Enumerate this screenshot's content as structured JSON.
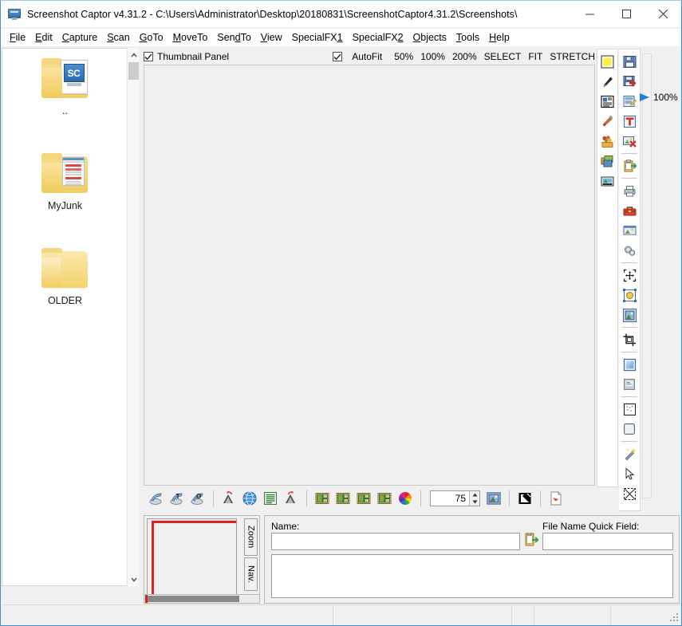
{
  "window": {
    "title": "Screenshot Captor v4.31.2 - C:\\Users\\Administrator\\Desktop\\20180831\\ScreenshotCaptor4.31.2\\Screenshots\\",
    "icon": "monitor-sc-icon",
    "minimize_label": "Minimize",
    "maximize_label": "Maximize",
    "close_label": "Close"
  },
  "menu": {
    "items": [
      {
        "label": "File",
        "accel": "F"
      },
      {
        "label": "Edit",
        "accel": "E"
      },
      {
        "label": "Capture",
        "accel": "C"
      },
      {
        "label": "Scan",
        "accel": "S"
      },
      {
        "label": "GoTo",
        "accel": "G"
      },
      {
        "label": "MoveTo",
        "accel": "M"
      },
      {
        "label": "SendTo",
        "accel": "T"
      },
      {
        "label": "View",
        "accel": "V"
      },
      {
        "label": "SpecialFX1",
        "accel": "1"
      },
      {
        "label": "SpecialFX2",
        "accel": "2"
      },
      {
        "label": "Objects",
        "accel": "O"
      },
      {
        "label": "Tools",
        "accel": "T"
      },
      {
        "label": "Help",
        "accel": "H"
      }
    ]
  },
  "file_browser": {
    "entries": [
      {
        "label": "..",
        "icon": "folder-with-sc-app-icon"
      },
      {
        "label": "MyJunk",
        "icon": "folder-with-screenshot-icon"
      },
      {
        "label": "OLDER",
        "icon": "folder-icon"
      }
    ],
    "scrollbar": {
      "up": "scroll-up-arrow",
      "down": "scroll-down-arrow"
    }
  },
  "thumbnail_header": {
    "thumbnail_panel_label": "Thumbnail Panel",
    "thumbnail_panel_checked": true,
    "autofit_label": "AutoFit",
    "autofit_checked": true,
    "zoom_options": [
      "50%",
      "100%",
      "200%",
      "SELECT",
      "FIT",
      "STRETCH"
    ]
  },
  "zoom_slider": {
    "value_label": "100%",
    "marker_color": "#1f7fd4"
  },
  "right_toolbar_1": {
    "tools": [
      {
        "name": "highlight-yellow-icon"
      },
      {
        "name": "eyedropper-icon"
      },
      {
        "name": "text-note-icon"
      },
      {
        "name": "paintbrush-icon"
      },
      {
        "name": "stamp-flower-icon"
      },
      {
        "name": "layers-icon"
      },
      {
        "name": "image-insert-icon"
      }
    ]
  },
  "right_toolbar_2": {
    "groups": [
      [
        {
          "name": "save-icon"
        },
        {
          "name": "save-as-new-icon"
        },
        {
          "name": "edit-image-icon"
        },
        {
          "name": "text-tool-icon"
        },
        {
          "name": "delete-image-icon"
        }
      ],
      [
        {
          "name": "export-clipboard-icon"
        }
      ],
      [
        {
          "name": "print-icon"
        },
        {
          "name": "toolbox-icon"
        },
        {
          "name": "slideshow-icon"
        },
        {
          "name": "settings-gears-icon"
        }
      ],
      [
        {
          "name": "select-region-icon"
        },
        {
          "name": "transform-object-icon"
        },
        {
          "name": "frame-image-icon"
        }
      ],
      [
        {
          "name": "crop-icon"
        }
      ],
      [
        {
          "name": "gradient-fill-icon"
        },
        {
          "name": "shadow-effect-icon"
        }
      ],
      [
        {
          "name": "dotted-border-icon"
        },
        {
          "name": "rounded-rect-icon"
        }
      ],
      [
        {
          "name": "magic-wand-icon"
        },
        {
          "name": "cursor-arrow-icon"
        },
        {
          "name": "transparency-icon"
        }
      ]
    ]
  },
  "bottom_toolbar": {
    "groups": [
      [
        {
          "name": "scan-image-icon"
        },
        {
          "name": "scan-text-icon"
        },
        {
          "name": "scan-ocr-icon"
        }
      ],
      [
        {
          "name": "rotate-left-icon"
        },
        {
          "name": "globe-web-icon"
        },
        {
          "name": "list-lines-icon"
        },
        {
          "name": "rotate-right-icon"
        }
      ],
      [
        {
          "name": "thumbnail-small-icon"
        },
        {
          "name": "thumbnail-medium-icon"
        },
        {
          "name": "thumbnail-large-icon"
        },
        {
          "name": "thumbnail-xlarge-icon"
        },
        {
          "name": "color-wheel-icon"
        }
      ]
    ],
    "quality_value": "75",
    "after_spin": [
      {
        "name": "image-preview-icon"
      },
      {
        "name": "invert-colors-icon"
      },
      {
        "name": "pdf-export-icon"
      }
    ]
  },
  "zoom_nav": {
    "zoom_tab_label": "Zoom",
    "nav_tab_label": "Nav."
  },
  "form": {
    "name_label": "Name:",
    "name_value": "",
    "name_placeholder": "",
    "browse_icon": "open-folder-icon",
    "quickfield_label": "File Name Quick Field:",
    "quickfield_value": "",
    "quickfield_placeholder": "",
    "notes_value": "",
    "notes_placeholder": ""
  },
  "statusbar": {
    "cells": [
      "",
      "",
      "",
      "",
      ""
    ]
  }
}
